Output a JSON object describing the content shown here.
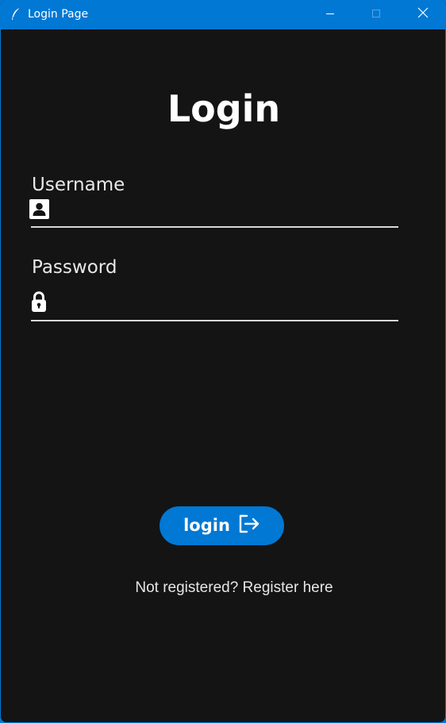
{
  "window": {
    "title": "Login Page",
    "controls": [
      "minimize-icon",
      "maximize-icon",
      "close-icon"
    ]
  },
  "form": {
    "heading": "Login",
    "username": {
      "label": "Username",
      "value": "",
      "icon": "user-card-icon"
    },
    "password": {
      "label": "Password",
      "value": "",
      "icon": "lock-icon"
    }
  },
  "actions": {
    "login_label": "login",
    "login_icon": "logout-arrow-icon",
    "register_text": "Not registered? Register here"
  },
  "colors": {
    "titlebar": "#0078d4",
    "background": "#141414",
    "accent": "#0078d4",
    "text": "#ffffff"
  }
}
